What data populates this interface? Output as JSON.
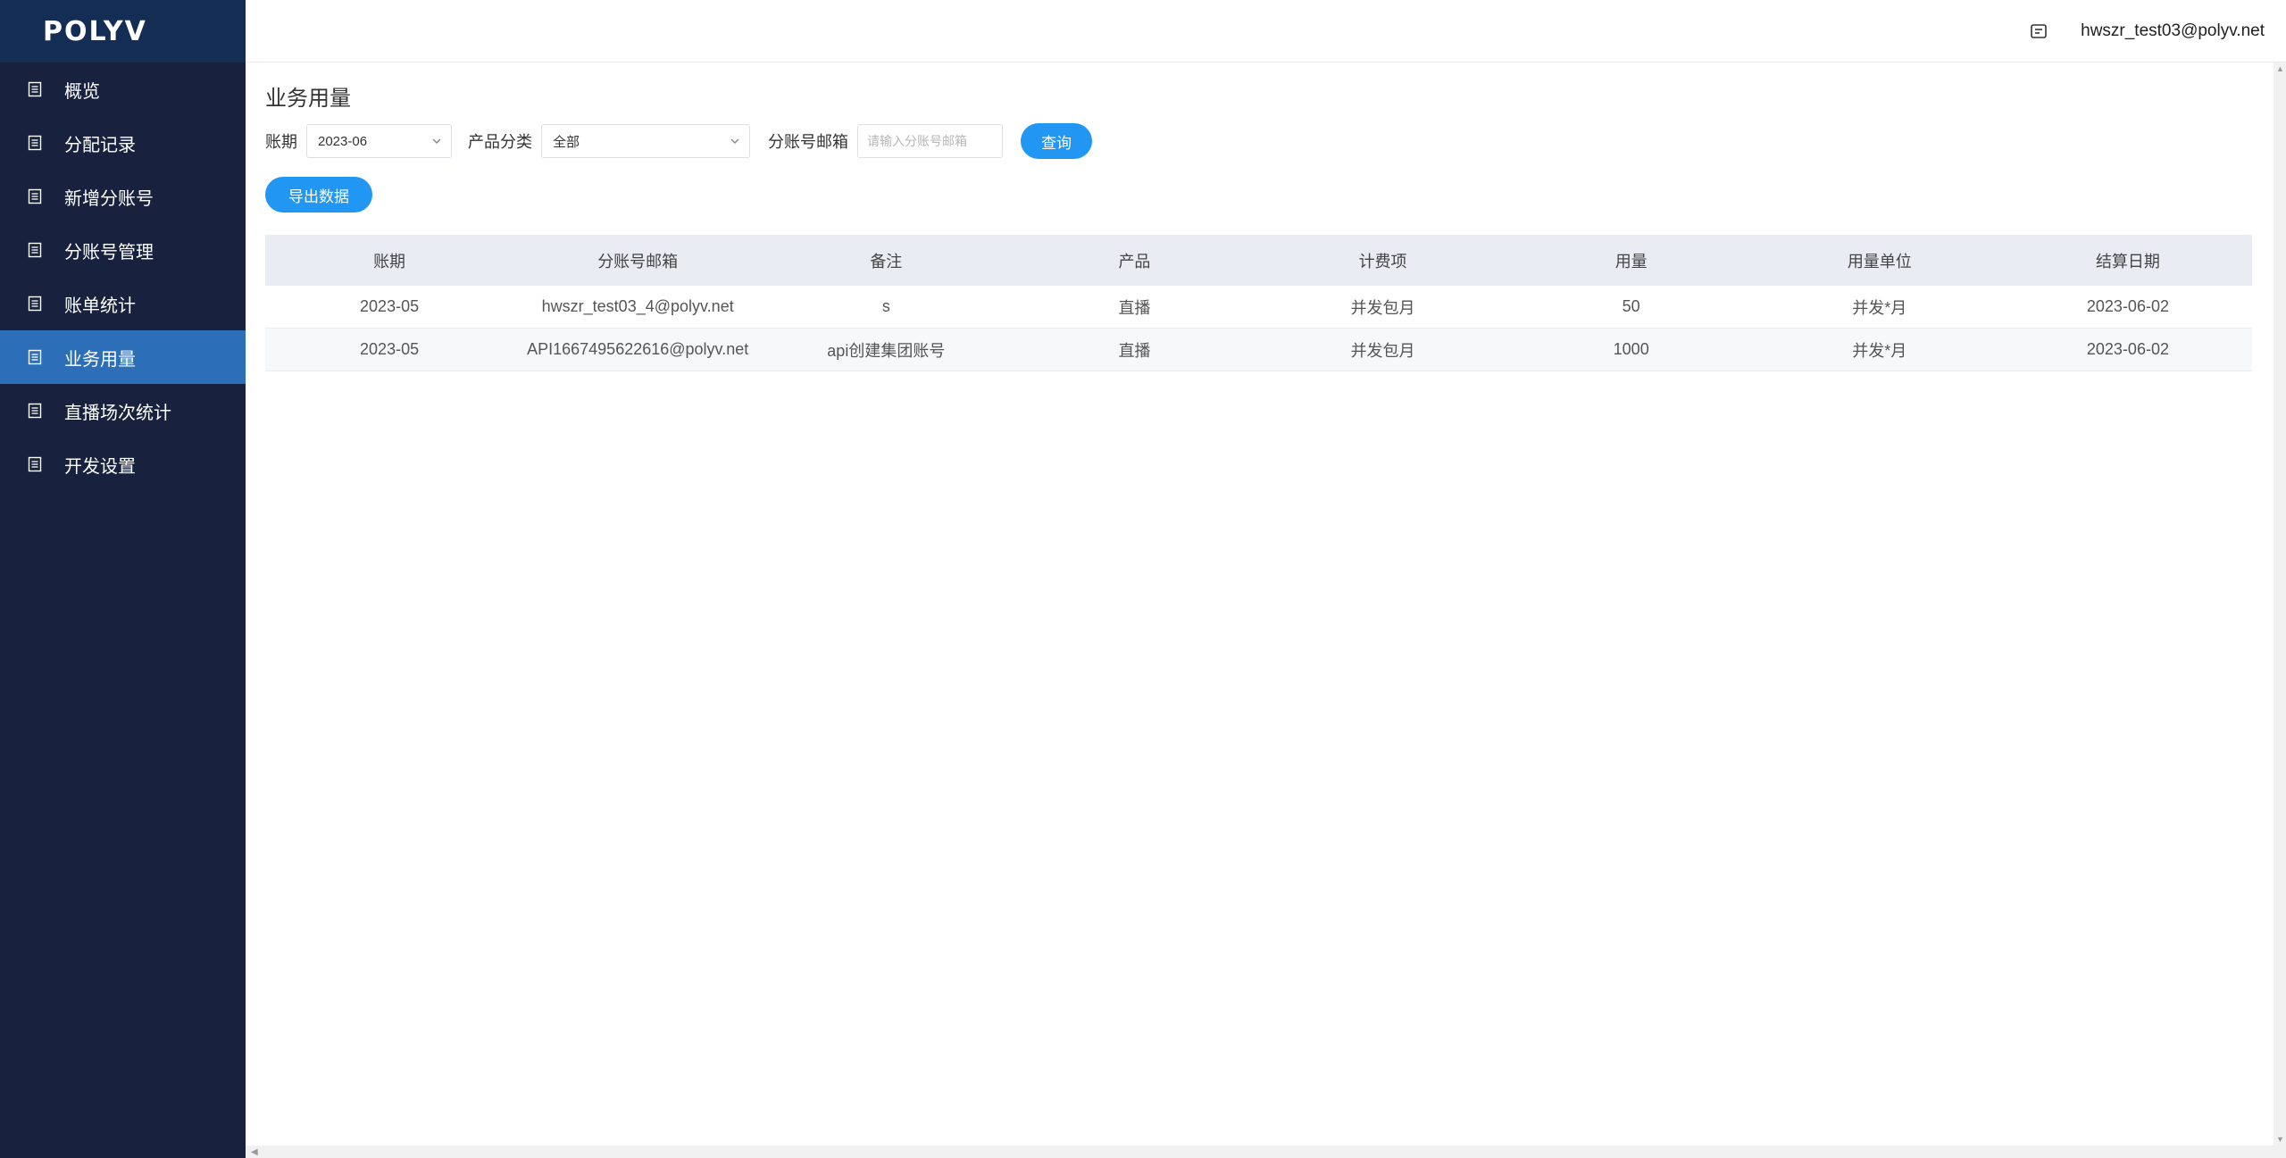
{
  "brand": {
    "logo_text": "POLYV"
  },
  "sidebar": {
    "items": [
      {
        "label": "概览",
        "icon": "document-icon",
        "active": false
      },
      {
        "label": "分配记录",
        "icon": "document-icon",
        "active": false
      },
      {
        "label": "新增分账号",
        "icon": "document-icon",
        "active": false
      },
      {
        "label": "分账号管理",
        "icon": "document-icon",
        "active": false
      },
      {
        "label": "账单统计",
        "icon": "document-icon",
        "active": false
      },
      {
        "label": "业务用量",
        "icon": "document-icon",
        "active": true
      },
      {
        "label": "直播场次统计",
        "icon": "document-icon",
        "active": false
      },
      {
        "label": "开发设置",
        "icon": "document-icon",
        "active": false
      }
    ]
  },
  "header": {
    "message_icon": "message-icon",
    "user_email": "hwszr_test03@polyv.net"
  },
  "page": {
    "title": "业务用量",
    "filters": {
      "period_label": "账期",
      "period_value": "2023-06",
      "category_label": "产品分类",
      "category_value": "全部",
      "email_label": "分账号邮箱",
      "email_placeholder": "请输入分账号邮箱",
      "query_label": "查询"
    },
    "export_label": "导出数据"
  },
  "table": {
    "columns": [
      "账期",
      "分账号邮箱",
      "备注",
      "产品",
      "计费项",
      "用量",
      "用量单位",
      "结算日期"
    ],
    "rows": [
      [
        "2023-05",
        "hwszr_test03_4@polyv.net",
        "s",
        "直播",
        "并发包月",
        "50",
        "并发*月",
        "2023-06-02"
      ],
      [
        "2023-05",
        "API1667495622616@polyv.net",
        "api创建集团账号",
        "直播",
        "并发包月",
        "1000",
        "并发*月",
        "2023-06-02"
      ]
    ]
  },
  "colors": {
    "sidebar_bg": "#18223f",
    "logo_bar_bg": "#132d55",
    "active_item_bg": "#2c6fb8",
    "primary_button": "#2196f3",
    "table_header_bg": "#e9edf3"
  }
}
